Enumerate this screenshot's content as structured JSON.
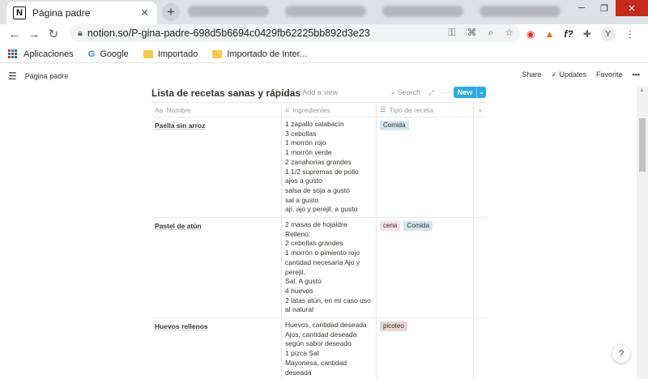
{
  "browser": {
    "tab_title": "Página padre",
    "url": "notion.so/P-gina-padre-698d5b6694c0429fb62225bb892d3e23",
    "bookmarks": [
      "Aplicaciones",
      "Google",
      "Importado",
      "Importado de Inter..."
    ]
  },
  "notion": {
    "breadcrumb": "Página padre",
    "topbar": {
      "share": "Share",
      "updates": "Updates",
      "favorite": "Favorite"
    },
    "db_title": "Lista de recetas sanas y rápidas",
    "add_view": "Add a view",
    "search": "Search",
    "new_button": "New",
    "columns": [
      "Nombre",
      "Ingredientes",
      "Tipo de receta"
    ],
    "rows": [
      {
        "name": "Paella sin arroz",
        "ingredients": [
          "1 zapallo calabacín",
          "3 cebollas",
          "1 morrón rojo",
          "1 morrón verde",
          "2 zanahorias grandes",
          "1 1/2 supremas de pollo",
          "ajos a gusto",
          "salsa de soja a gusto",
          "sal a gusto",
          "ají, ajo y perejil, a gusto"
        ],
        "tags": [
          {
            "label": "Comida",
            "color": "#d3e5ef"
          }
        ]
      },
      {
        "name": "Pastel de atún",
        "ingredients": [
          "2 masas de hojaldre",
          "Relleno:",
          "2 cebollas grandes",
          "1 morrón o pimiento rojo",
          "cantidad necesaria Ajo y",
          "perejil,",
          "Sal. A gusto",
          "4 huevos",
          "2 latas atún, en mi caso uso",
          "al natural"
        ],
        "tags": [
          {
            "label": "cena",
            "color": "#f5e0e9"
          },
          {
            "label": "Comida",
            "color": "#d3e5ef"
          }
        ]
      },
      {
        "name": "Huevos rellenos",
        "ingredients": [
          "Huevos, cantidad deseada",
          "Ajos, cantidad deseada",
          "según sabor deseado",
          "1 pizca Sal",
          "Mayonesa, cantidad deseada"
        ],
        "tags": [
          {
            "label": "picoteo",
            "color": "#e9d5cf"
          }
        ]
      }
    ]
  }
}
